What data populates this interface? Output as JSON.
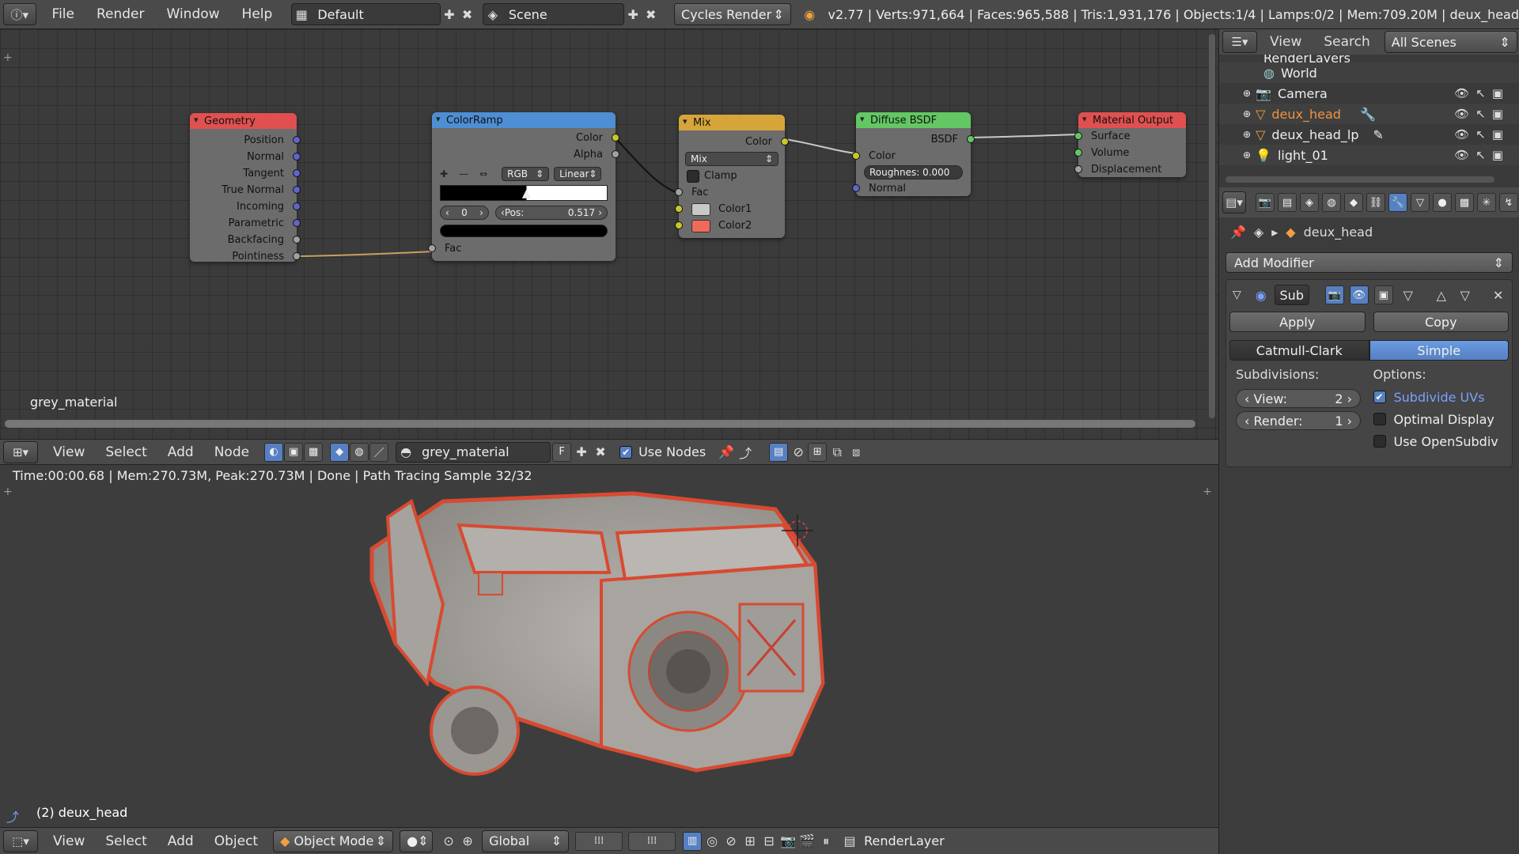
{
  "topbar": {
    "menus": [
      "File",
      "Render",
      "Window",
      "Help"
    ],
    "layout": "Default",
    "scene": "Scene",
    "engine": "Cycles Render",
    "stats": "v2.77 | Verts:971,664 | Faces:965,588 | Tris:1,931,176 | Objects:1/4 | Lamps:0/2 | Mem:709.20M | deux_head"
  },
  "nodes": {
    "geometry": {
      "title": "Geometry",
      "outputs": [
        "Position",
        "Normal",
        "Tangent",
        "True Normal",
        "Incoming",
        "Parametric",
        "Backfacing",
        "Pointiness"
      ],
      "color": "#e05050"
    },
    "colorramp": {
      "title": "ColorRamp",
      "out_color": "Color",
      "out_alpha": "Alpha",
      "mode": "RGB",
      "interp": "Linear",
      "index": "0",
      "pos_label": "Pos:",
      "pos_value": "0.517",
      "in_fac": "Fac",
      "color": "#4e8ed4"
    },
    "mix": {
      "title": "Mix",
      "out_color": "Color",
      "blend": "Mix",
      "clamp": "Clamp",
      "fac": "Fac",
      "color1": "Color1",
      "color2": "Color2",
      "color1_swatch": "#c8c8c8",
      "color2_swatch": "#f06a5a",
      "color": "#d6a53a"
    },
    "diffuse": {
      "title": "Diffuse BSDF",
      "out_bsdf": "BSDF",
      "in_color": "Color",
      "roughness": "Roughnes: 0.000",
      "in_normal": "Normal",
      "color": "#63c763"
    },
    "output": {
      "title": "Material Output",
      "surface": "Surface",
      "volume": "Volume",
      "displacement": "Displacement",
      "color": "#e05050"
    },
    "editor_label": "grey_material"
  },
  "node_header": {
    "menus": [
      "View",
      "Select",
      "Add",
      "Node"
    ],
    "material": "grey_material",
    "fake_user": "F",
    "use_nodes": "Use Nodes"
  },
  "render": {
    "info": "Time:00:00.68 | Mem:270.73M, Peak:270.73M | Done | Path Tracing Sample 32/32",
    "object_label": "(2) deux_head"
  },
  "viewport_header": {
    "menus": [
      "View",
      "Select",
      "Add",
      "Object"
    ],
    "mode": "Object Mode",
    "orientation": "Global",
    "render_layer": "RenderLayer"
  },
  "outliner": {
    "menus": [
      "View",
      "Search"
    ],
    "scenes": "All Scenes",
    "items": [
      {
        "name": "RenderLayers",
        "icon": "render-layers-icon"
      },
      {
        "name": "World",
        "icon": "world-icon"
      },
      {
        "name": "Camera",
        "icon": "camera-icon"
      },
      {
        "name": "deux_head",
        "icon": "mesh-icon"
      },
      {
        "name": "deux_head_lp",
        "icon": "mesh-icon"
      },
      {
        "name": "light_01",
        "icon": "lamp-icon"
      }
    ]
  },
  "properties": {
    "object": "deux_head",
    "add_modifier": "Add Modifier",
    "mod_name": "Sub",
    "apply": "Apply",
    "copy": "Copy",
    "catmull": "Catmull-Clark",
    "simple": "Simple",
    "subdivisions": "Subdivisions:",
    "options": "Options:",
    "view_label": "View:",
    "view_value": "2",
    "render_label": "Render:",
    "render_value": "1",
    "subdivide_uvs": "Subdivide UVs",
    "optimal_display": "Optimal Display",
    "use_opensubdiv": "Use OpenSubdiv"
  },
  "accent": "#5680c2"
}
